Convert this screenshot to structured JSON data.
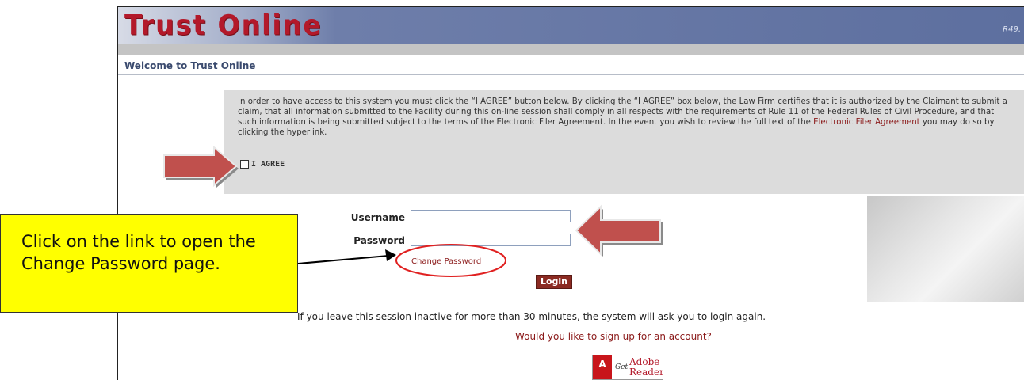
{
  "header": {
    "logo_text": "Trust Online",
    "version": "R49."
  },
  "page": {
    "title": "Welcome to Trust Online"
  },
  "agreement": {
    "text_before_link": "In order to have access to this system you must click the “I AGREE” button below. By clicking the “I AGREE” box below, the Law Firm certifies that it is authorized by the Claimant to submit a claim, that all information submitted to the Facility during this on-line session shall comply in all respects with the requirements of Rule 11 of the Federal Rules of Civil Procedure, and that such information is being submitted subject to the terms of the Electronic Filer Agreement. In the event you wish to review the full text of the ",
    "link_text": "Electronic Filer Agreement",
    "text_after_link": " you may do so by clicking the hyperlink.",
    "checkbox_label": "I AGREE"
  },
  "login": {
    "username_label": "Username",
    "username_value": "",
    "password_label": "Password",
    "password_value": "",
    "change_password_link": "Change Password",
    "login_button": "Login"
  },
  "footer": {
    "inactive_notice": "If you leave this session inactive for more than 30 minutes, the system will ask you to login again.",
    "signup_link": "Would you like to sign up for an account?",
    "adobe_badge": {
      "brand": "Adobe",
      "get": "Get",
      "line1": "Adobe",
      "line2": "Reader"
    }
  },
  "annotation": {
    "callout_text": "Click on the link to open the Change Password page."
  },
  "colors": {
    "banner": "#5d6f9f",
    "logo": "#b3192a",
    "link": "#8b1a1a",
    "callout": "#ffff00",
    "arrow": "#c0504d",
    "highlight_ring": "#e02020"
  }
}
